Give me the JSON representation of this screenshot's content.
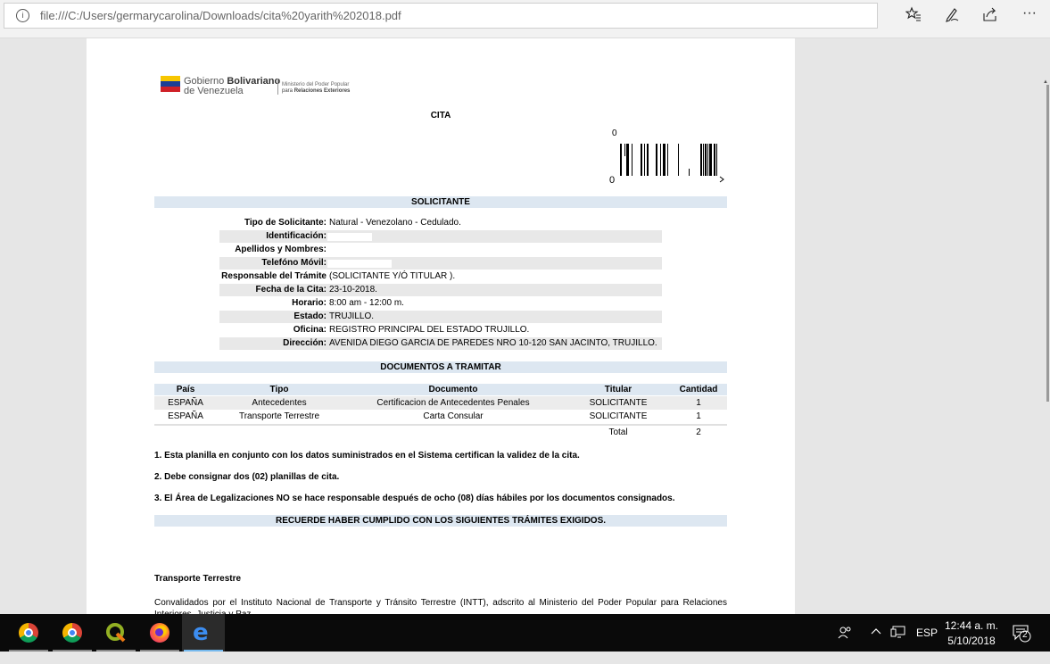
{
  "browser": {
    "url": "file:///C:/Users/germarycarolina/Downloads/cita%20yarith%202018.pdf",
    "toolbar_icons": [
      "favorites-star-icon",
      "pen-icon",
      "share-icon",
      "more-icon"
    ],
    "more_label": "···"
  },
  "logo": {
    "line1_light": "Gobierno",
    "line1_bold": "Bolivariano",
    "line2": "de Venezuela",
    "ministry1": "Ministerio del Poder Popular",
    "ministry2_prefix": "para",
    "ministry2_bold": "Relaciones Exteriores"
  },
  "document": {
    "title": "CITA",
    "barcode_top": "0",
    "barcode_bottom": "0",
    "solicitante_header": "SOLICITANTE",
    "solicitante": [
      {
        "label": "Tipo de Solicitante:",
        "value": "Natural - Venezolano - Cedulado."
      },
      {
        "label": "Identificación:",
        "value": ""
      },
      {
        "label": "Apellidos y Nombres:",
        "value": ""
      },
      {
        "label": "Telefóno Móvil:",
        "value": ""
      },
      {
        "label": "Responsable del Trámite",
        "value": "(SOLICITANTE Y/Ó TITULAR )."
      },
      {
        "label": "Fecha de la Cita:",
        "value": "23-10-2018."
      },
      {
        "label": "Horario:",
        "value": "8:00 am - 12:00 m."
      },
      {
        "label": "Estado:",
        "value": "TRUJILLO."
      },
      {
        "label": "Oficina:",
        "value": "REGISTRO PRINCIPAL DEL ESTADO TRUJILLO."
      },
      {
        "label": "Dirección:",
        "value": "AVENIDA DIEGO GARCIA DE PAREDES NRO 10-120 SAN JACINTO, TRUJILLO."
      }
    ],
    "docs_header": "DOCUMENTOS A TRAMITAR",
    "docs_columns": [
      "País",
      "Tipo",
      "Documento",
      "Titular",
      "Cantidad"
    ],
    "docs_rows": [
      [
        "ESPAÑA",
        "Antecedentes",
        "Certificacion de Antecedentes Penales",
        "SOLICITANTE",
        "1"
      ],
      [
        "ESPAÑA",
        "Transporte Terrestre",
        "Carta Consular",
        "SOLICITANTE",
        "1"
      ]
    ],
    "total_label": "Total",
    "total_value": "2",
    "notes": [
      "1. Esta planilla en conjunto con los datos suministrados en el Sistema certifican la validez de la cita.",
      "2. Debe consignar dos (02) planillas de cita.",
      "3. El Área de Legalizaciones NO se hace responsable después de ocho (08) días hábiles por los documentos consignados."
    ],
    "reminder": "RECUERDE HABER CUMPLIDO CON LOS SIGUIENTES TRÁMITES EXIGIDOS.",
    "section_title": "Transporte Terrestre",
    "paragraph": "Convalidados por el Instituto Nacional de Transporte y Tránsito Terrestre (INTT), adscrito al Ministerio del Poder Popular para Relaciones Interiores, Justicia y Paz."
  },
  "taskbar": {
    "apps": [
      "chrome-icon",
      "chrome-icon",
      "qgis-icon",
      "firefox-icon",
      "edge-icon"
    ],
    "language": "ESP",
    "time": "12:44 a. m.",
    "date": "5/10/2018",
    "notifications": "2"
  }
}
